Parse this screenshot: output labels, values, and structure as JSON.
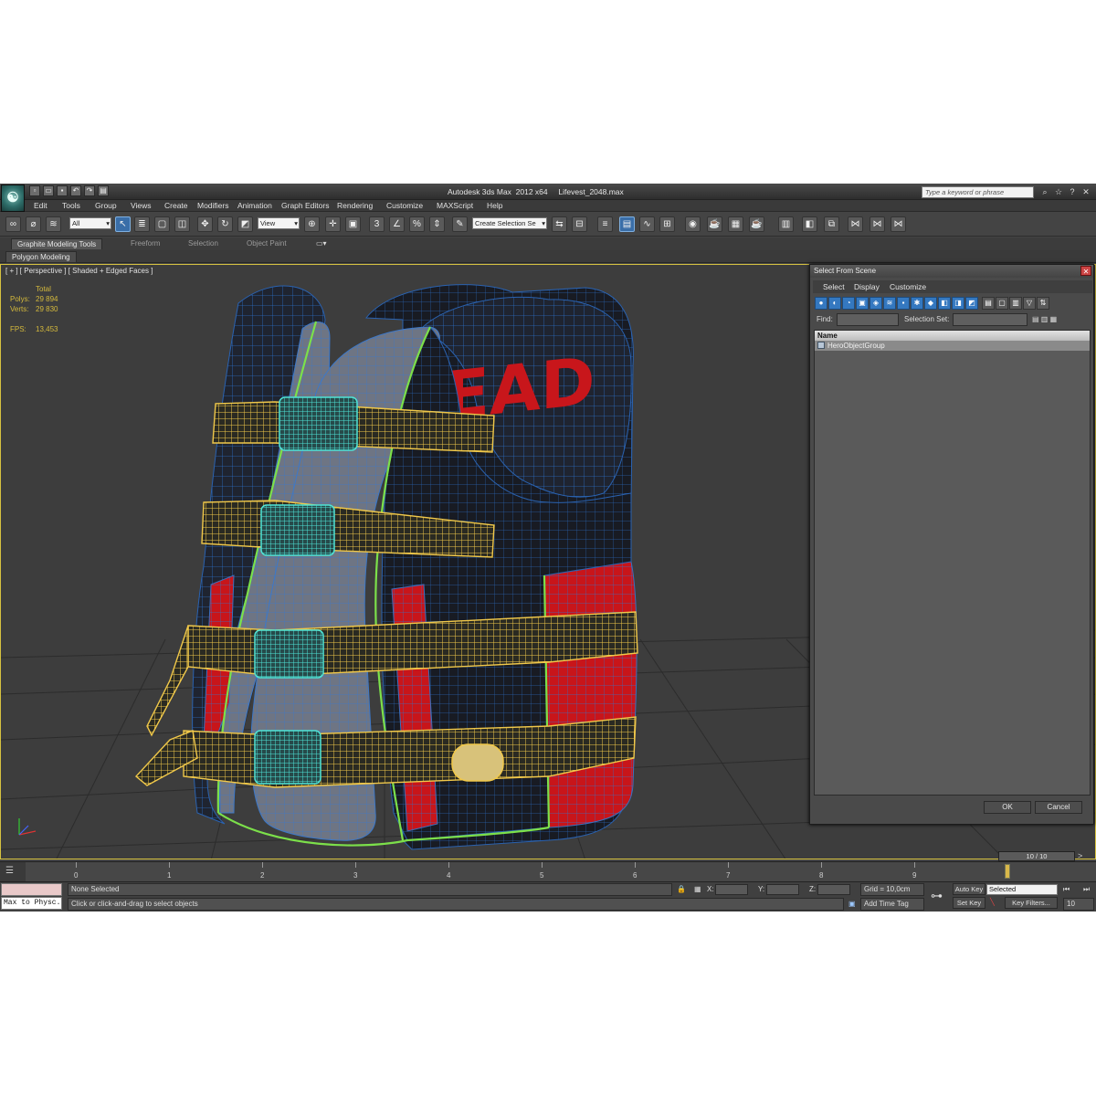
{
  "window": {
    "title": "Autodesk 3ds Max  2012 x64     Lifevest_2048.max",
    "search_placeholder": "Type a keyword or phrase",
    "logo": "3ds Max logo",
    "title_icons": [
      "binoculars-icon",
      "star-icon",
      "help-icon",
      "minimize-icon"
    ]
  },
  "quick_access": [
    "new",
    "open",
    "save",
    "undo",
    "redo",
    "project"
  ],
  "menubar": [
    "Edit",
    "Tools",
    "Group",
    "Views",
    "Create",
    "Modifiers",
    "Animation",
    "Graph Editors",
    "Rendering",
    "Customize",
    "MAXScript",
    "Help"
  ],
  "main_toolbar": {
    "selection_filter": "All",
    "reference_coord": "View",
    "named_selection": "Create Selection Se"
  },
  "ribbon": {
    "tabs": [
      "Graphite Modeling Tools",
      "Freeform",
      "Selection",
      "Object Paint"
    ],
    "panel_label": "Polygon Modeling"
  },
  "viewport": {
    "label": "[ + ] [ Perspective ] [ Shaded + Edged Faces ]",
    "stats": {
      "total_label": "Total",
      "polys_label": "Polys:",
      "polys_value": "29 894",
      "verts_label": "Verts:",
      "verts_value": "29 830",
      "fps_label": "FPS:",
      "fps_value": "13,453"
    },
    "model_text": "LEAD"
  },
  "dialog": {
    "title": "Select From Scene",
    "menus": [
      "Select",
      "Display",
      "Customize"
    ],
    "find_label": "Find:",
    "selection_set_label": "Selection Set:",
    "list_header": "Name",
    "items": [
      "HeroObjectGroup"
    ],
    "ok": "OK",
    "cancel": "Cancel"
  },
  "timeline": {
    "frame_counter": "10 / 10",
    "ticks": [
      "0",
      "1",
      "2",
      "3",
      "4",
      "5",
      "6",
      "7",
      "8",
      "9"
    ]
  },
  "status": {
    "listener_text": "Max to Physc.",
    "selection_text": "None Selected",
    "prompt_text": "Click or click-and-drag to select objects",
    "x_label": "X:",
    "y_label": "Y:",
    "z_label": "Z:",
    "grid_text": "Grid = 10,0cm",
    "add_time_tag": "Add Time Tag",
    "auto_key": "Auto Key",
    "set_key": "Set Key",
    "key_mode": "Selected",
    "key_filters": "Key Filters...",
    "frame_field": "10"
  }
}
